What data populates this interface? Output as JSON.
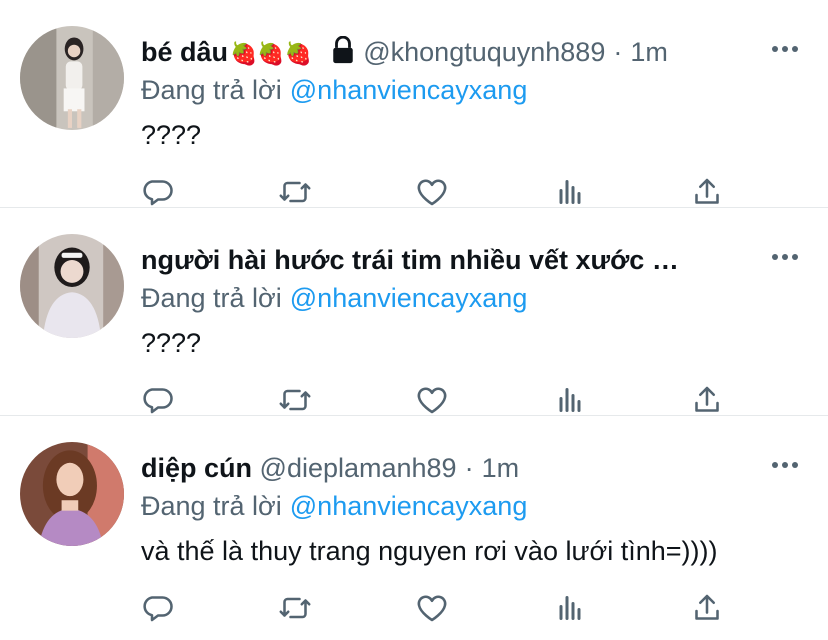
{
  "tweets": [
    {
      "name": "bé dâu",
      "emoji": "🍓🍓🍓",
      "protected": true,
      "handle": "@khongtuquynh889",
      "dot": "·",
      "time": "1m",
      "reply_prefix": "Đang trả lời",
      "reply_to": "@nhanviencayxang",
      "text": "????",
      "avatar": {
        "bg": "#c9c4bd",
        "skin": "#e8d2c4",
        "hair": "#2a2424",
        "cloth": "#f2f0ed"
      }
    },
    {
      "name": "người hài hước trái tim nhiều vết xước …",
      "handle": "",
      "dot": "",
      "time": "",
      "reply_prefix": "Đang trả lời",
      "reply_to": "@nhanviencayxang",
      "text": "????",
      "avatar": {
        "bg": "#cfc7c2",
        "skin": "#ecd9cf",
        "hair": "#1f1b1b",
        "cloth": "#e9e6ee"
      }
    },
    {
      "name": "diệp cún",
      "handle": "@dieplamanh89",
      "dot": "·",
      "time": "1m",
      "reply_prefix": "Đang trả lời",
      "reply_to": "@nhanviencayxang",
      "text": "và thế là thuy trang nguyen rơi vào lưới tình=))))",
      "avatar": {
        "bg": "#7a4a3a",
        "skin": "#f1cdb8",
        "hair": "#6b3a24",
        "cloth": "#b58ac4"
      }
    }
  ],
  "icons": {
    "reply": "reply-icon",
    "retweet": "retweet-icon",
    "like": "heart-icon",
    "stats": "stats-icon",
    "share": "share-icon",
    "more": "more-icon",
    "lock": "lock-icon"
  },
  "colors": {
    "text": "#0f1419",
    "secondary": "#536471",
    "link": "#1d9bf0",
    "divider": "#e6e9eb"
  }
}
